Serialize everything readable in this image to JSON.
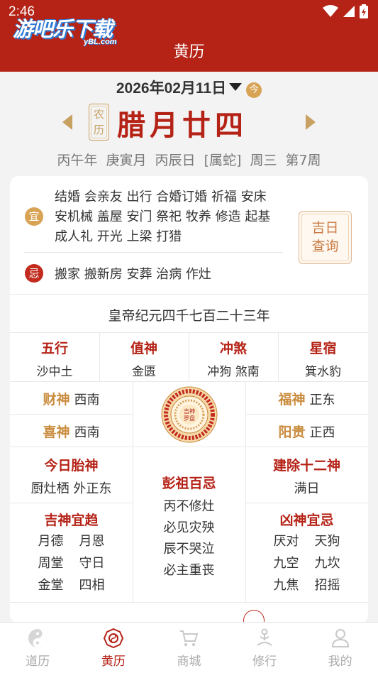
{
  "status": {
    "time": "2:46"
  },
  "logo": {
    "main": "游吧乐下载",
    "sub": "yBL.com"
  },
  "header": {
    "title": "黄历"
  },
  "date": {
    "text": "2026年02月11日",
    "today_label": "今"
  },
  "lunar": {
    "label_top": "农",
    "label_bottom": "历",
    "text": "腊月廿四"
  },
  "ganzhi": {
    "year": "丙午年",
    "month": "庚寅月",
    "day": "丙辰日",
    "zodiac": "[属蛇]",
    "weekday": "周三",
    "week": "第7周"
  },
  "yi": {
    "badge": "宜",
    "line1": "结婚 会亲友 出行 合婚订婚 祈福 安床",
    "line2": "安机械 盖屋 安门 祭祀 牧养 修造 起基",
    "line3": "成人礼 开光 上梁 打猎"
  },
  "ji": {
    "badge": "忌",
    "text": "搬家 搬新房 安葬 治病 作灶"
  },
  "jiri_button": {
    "line1": "吉日",
    "line2": "查询"
  },
  "era": "皇帝纪元四千七百二十三年",
  "row1": [
    {
      "title": "五行",
      "value": "沙中土"
    },
    {
      "title": "值神",
      "value": "金匮"
    },
    {
      "title": "冲煞",
      "value": "冲狗 煞南"
    },
    {
      "title": "星宿",
      "value": "箕水豹"
    }
  ],
  "gods": {
    "caishen": {
      "title": "财神",
      "value": "西南"
    },
    "xishen": {
      "title": "喜神",
      "value": "西南"
    },
    "fushen": {
      "title": "福神",
      "value": "正东"
    },
    "yanggui": {
      "title": "阳贵",
      "value": "正西"
    },
    "compass_center_line1": "吉神",
    "compass_center_line2": "罗盘"
  },
  "taishen": {
    "title": "今日胎神",
    "value": "厨灶栖 外正东"
  },
  "pengzu": {
    "title": "彭祖百忌",
    "lines": [
      "丙不修灶",
      "必见灾殃",
      "辰不哭泣",
      "必主重丧"
    ]
  },
  "jianchu": {
    "title": "建除十二神",
    "value": "满日"
  },
  "jishen": {
    "title": "吉神宜趋",
    "items": [
      "月德",
      "月恩",
      "周堂",
      "守日",
      "金堂",
      "四相"
    ]
  },
  "xiongshen": {
    "title": "凶神宜忌",
    "items": [
      "厌对",
      "天狗",
      "九空",
      "九坎",
      "九焦",
      "招摇"
    ]
  },
  "nav": [
    {
      "label": "道历",
      "icon": "yin-yang-icon",
      "active": false
    },
    {
      "label": "黄历",
      "icon": "bagua-icon",
      "active": true
    },
    {
      "label": "商城",
      "icon": "cart-icon",
      "active": false
    },
    {
      "label": "修行",
      "icon": "meditation-icon",
      "active": false
    },
    {
      "label": "我的",
      "icon": "user-icon",
      "active": false
    }
  ],
  "colors": {
    "primary": "#b52216",
    "gold": "#c98b3c",
    "yi_badge": "#d8a355",
    "ji_badge": "#c22b1e"
  }
}
